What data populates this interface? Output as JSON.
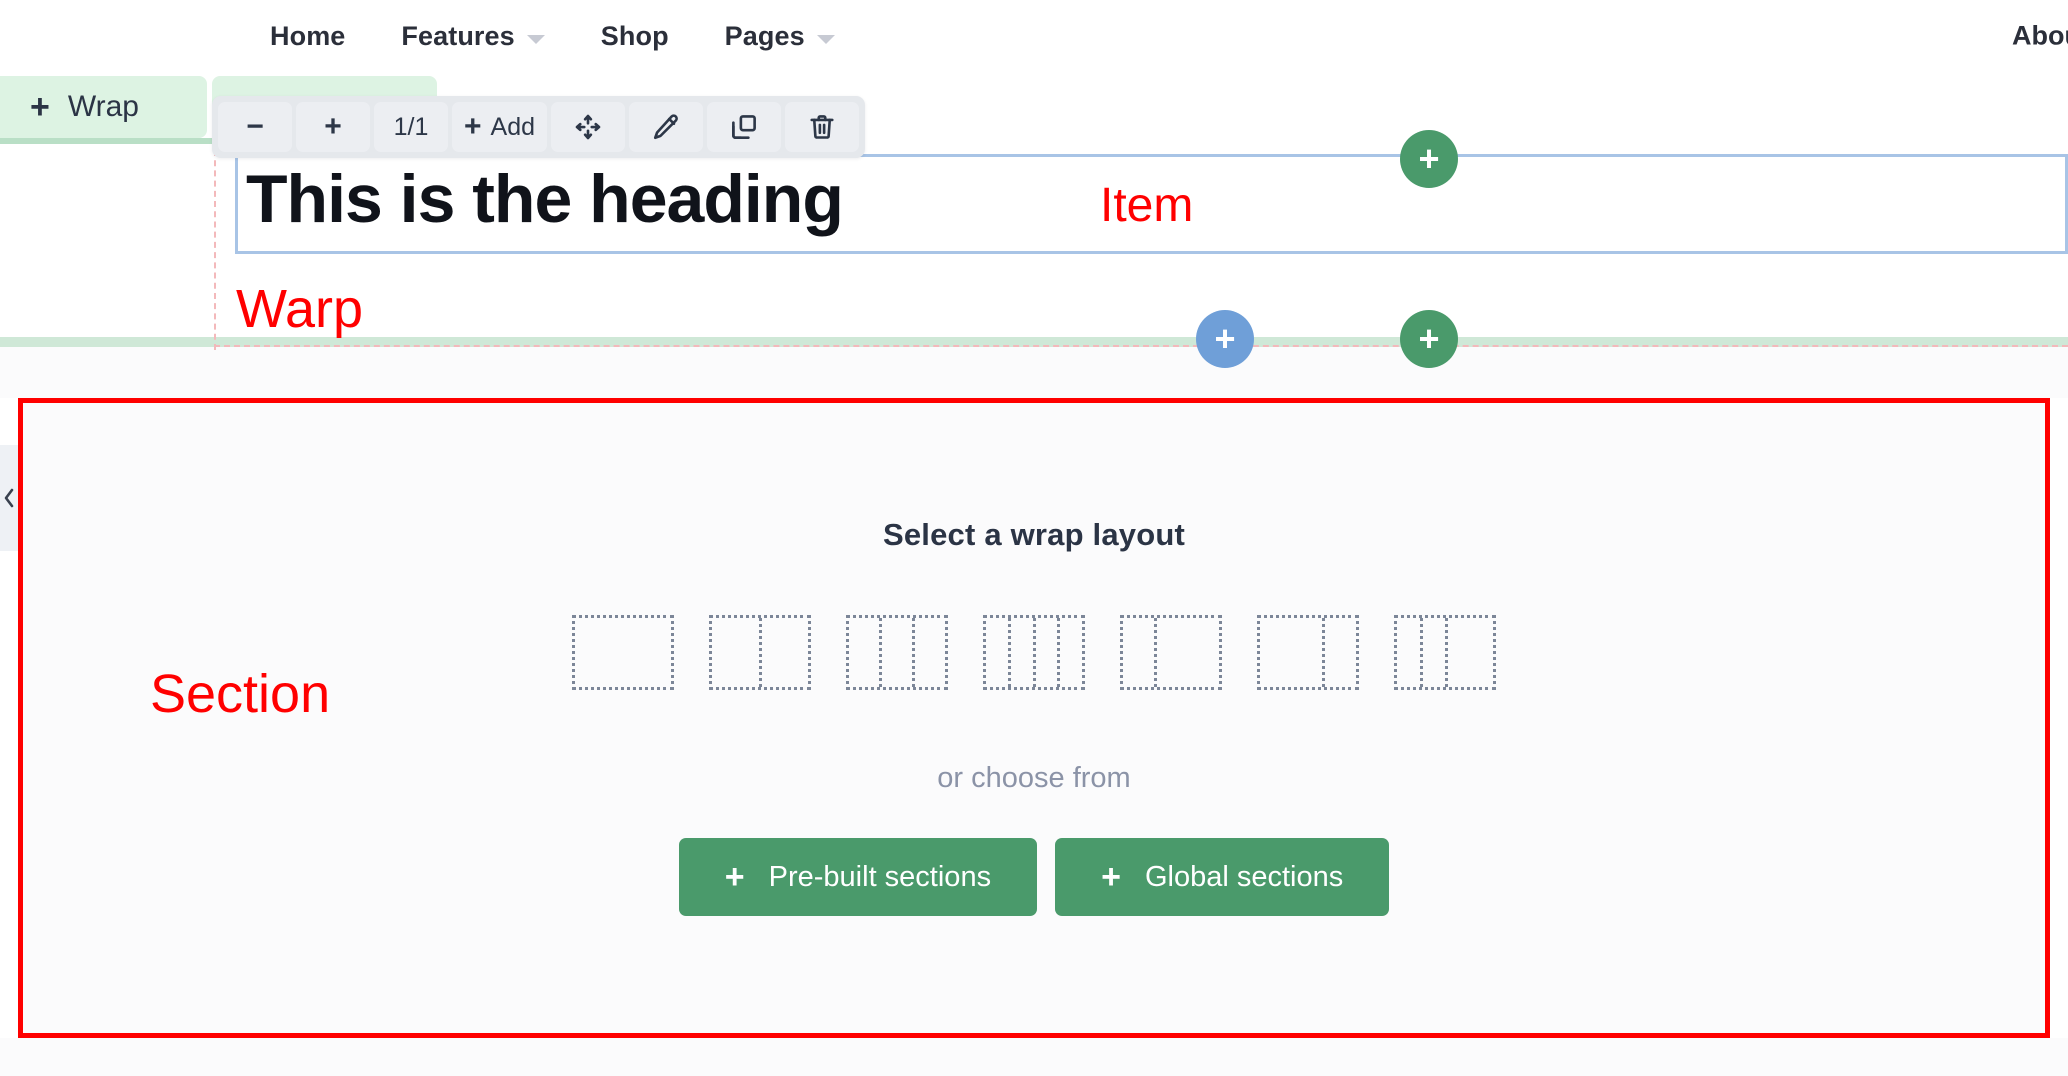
{
  "site_nav": {
    "items": [
      {
        "label": "Home",
        "has_caret": false
      },
      {
        "label": "Features",
        "has_caret": true
      },
      {
        "label": "Shop",
        "has_caret": false
      },
      {
        "label": "Pages",
        "has_caret": true
      }
    ],
    "right_item": "About"
  },
  "wrap_tab": {
    "plus": "+",
    "label": "Wrap"
  },
  "element_toolbar": {
    "decrement_label": "−",
    "increment_label": "+",
    "counter_label": "1/1",
    "add_plus": "+",
    "add_label": "Add",
    "icons": [
      "move-icon",
      "edit-icon",
      "duplicate-icon",
      "delete-icon"
    ]
  },
  "canvas": {
    "heading": "This is the heading"
  },
  "annotations": {
    "item": "Item",
    "warp": "Warp",
    "section": "Section"
  },
  "add_buttons": {
    "top_green": "+",
    "row_blue": "+",
    "row_green": "+"
  },
  "section_empty_state": {
    "title": "Select a wrap layout",
    "or_text": "or choose from",
    "layouts": [
      {
        "name": "layout-1-column",
        "columns": [
          1
        ]
      },
      {
        "name": "layout-2-column",
        "columns": [
          1,
          1
        ]
      },
      {
        "name": "layout-3-column",
        "columns": [
          1,
          1,
          1
        ]
      },
      {
        "name": "layout-4-column",
        "columns": [
          1,
          1,
          1,
          1
        ]
      },
      {
        "name": "layout-2-column-narrow-wide",
        "columns": [
          1,
          2
        ]
      },
      {
        "name": "layout-2-column-wide-narrow",
        "columns": [
          2,
          1
        ]
      },
      {
        "name": "layout-3-column-uneven",
        "columns": [
          1,
          1,
          2
        ]
      }
    ],
    "prebuilt_button": {
      "plus": "+",
      "label": "Pre-built sections"
    },
    "global_button": {
      "plus": "+",
      "label": "Global sections"
    }
  },
  "left_collapse": {
    "icon": "chevron-left-icon"
  },
  "colors": {
    "green_accent": "#4a9a6b",
    "blue_accent": "#6f9fd8",
    "annotation_red": "#ff0000",
    "selection_blue": "#a8c4e6",
    "tab_green_bg": "#ddf3e3",
    "toolbar_bg": "#e5e8ec",
    "muted_text": "#8b93a7",
    "dark_text": "#2b3445"
  }
}
